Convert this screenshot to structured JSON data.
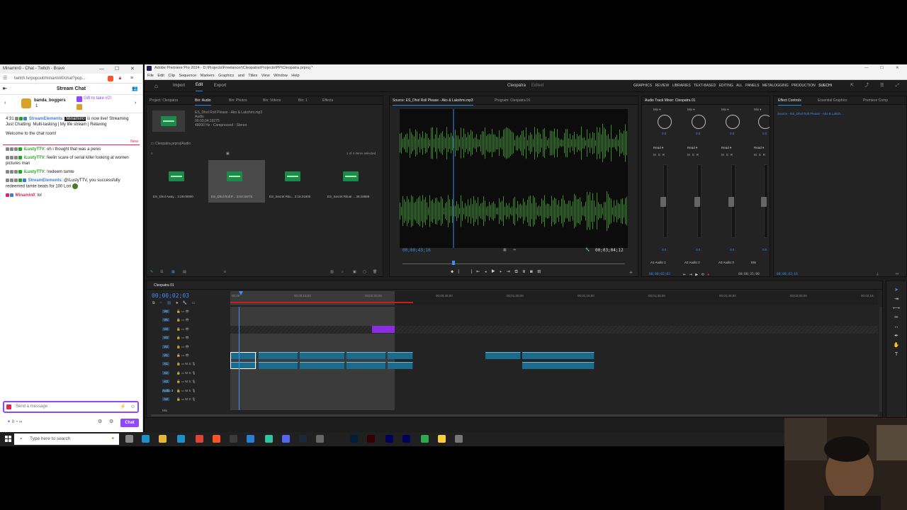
{
  "chat": {
    "window_title": "Minamin0 - Chat - Twitch - Brave",
    "url": "twitch.tv/popout/minamin0/chat?pop...",
    "panel_title": "Stream Chat",
    "hype_user": "banda_boggers",
    "hype_count": "1",
    "gift_text": "Gift to take #2!",
    "messages": [
      {
        "time": "4:31",
        "user": "StreamElements",
        "tag": "Minamin0",
        "text": "is now live! Streaming Just Chatting: Multi-tasking | My life stream | Relaxing",
        "color": "blue"
      },
      {
        "text": "Welcome to the chat room!"
      },
      {
        "user": "iLustyTTV",
        "text": "oh i thought that was a penis",
        "color": "green"
      },
      {
        "user": "iLustyTTV",
        "text": "feelin scare of serial killer looking at women pictures man",
        "color": "green"
      },
      {
        "user": "iLustyTTV",
        "text": "!redeem tamte",
        "color": "green"
      },
      {
        "user": "StreamElements",
        "text": "@iLustyTTV, you successfully redeemed tamte beats for 100 Lori",
        "color": "blue"
      },
      {
        "user": "Minamin0",
        "text": "lol",
        "color": "red"
      }
    ],
    "new_label": "New",
    "input_placeholder": "Send a message",
    "points": "0",
    "chat_button": "Chat"
  },
  "premiere": {
    "title": "Adobe Premiere Pro 2024 - D:\\Projects\\Freelancer\\Cleopatra\\Projects\\PP\\Cleopatra.prproj *",
    "menu": [
      "File",
      "Edit",
      "Clip",
      "Sequence",
      "Markers",
      "Graphics and Titles",
      "View",
      "Window",
      "Help"
    ],
    "toolbar": {
      "home": "⌂",
      "import": "Import",
      "edit": "Edit",
      "export": "Export",
      "project_name": "Cleopatra",
      "edited": "Edited"
    },
    "workspaces": [
      "GRAPHICS",
      "REVIEW",
      "LIBRARIES",
      "TEXT-BASED EDITING",
      "ALL PANELS",
      "METALOGGING",
      "PRODUCTION",
      "SUECHI"
    ],
    "project_tabs": [
      "Project: Cleopatra",
      "Bin: Audio",
      "Bin: Photos",
      "Bin: Videos",
      "Bin: 1",
      "Effects"
    ],
    "clip_info": {
      "name": "ES_Dhol Roll Please - Ako & Lakshmi.mp3",
      "type": "Audio",
      "duration": "00;03;04;19275",
      "format": "48000 Hz - Compressed - Stereo"
    },
    "bin_path": "Cleopatra.prproj\\Audio",
    "items_selected": "1 of 4 items selected",
    "bin_items": [
      {
        "name": "ES_Dhol Away...",
        "dur": "2:28:00000"
      },
      {
        "name": "ES_Dhol Roll P...",
        "dur": "3:04:19275"
      },
      {
        "name": "ES_Secret Ritu...",
        "dur": "2:18:21600"
      },
      {
        "name": "ES_Secret Ritual ...",
        "dur": "35;18588"
      }
    ],
    "source_tab": "Source: ES_Dhol Roll Please - Ako & Lakshmi.mp3",
    "program_tab": "Program: Cleopatra 01",
    "source_tc_in": "00;00;43;16",
    "source_tc_dur": "00;03;04;12",
    "mixer_tab": "Audio Track Mixer: Cleopatra 01",
    "mixer_channels": [
      {
        "read": "Read",
        "name": "Audio 1",
        "id": "A1"
      },
      {
        "read": "Read",
        "name": "Audio 2",
        "id": "A2"
      },
      {
        "read": "Read",
        "name": "Audio 3",
        "id": "A3"
      },
      {
        "read": "Read",
        "name": "",
        "id": "Mix"
      }
    ],
    "mixer_tc_left": "00;00;02;03",
    "mixer_tc_right": "00;00;35;00",
    "effect_tabs": [
      "Effect Controls",
      "Essential Graphics",
      "Premiere Comp"
    ],
    "effect_source": "Source - ES_Dhol Roll Please - Ako & Laksh...",
    "effect_tc": "00;00;43;16",
    "timeline_tab": "Cleopatra 01",
    "timeline_tc": "00;00;02;03",
    "ruler": [
      "00;00",
      "00;00;15;00",
      "00;00;30;00",
      "00;00;45;00",
      "00;01;00;00",
      "00;01;15;00",
      "00;01;30;00",
      "00;01;45;00",
      "00;02;00;00",
      "00;02;15;"
    ],
    "tracks_video": [
      "V6",
      "V5",
      "V4",
      "V3",
      "V2",
      "V1"
    ],
    "tracks_audio": [
      "A1",
      "A2",
      "A3",
      "Audio 3",
      "A4"
    ],
    "mix_label": "Mix",
    "mix_value": "0.0"
  },
  "taskbar": {
    "search_placeholder": "Type here to search"
  }
}
